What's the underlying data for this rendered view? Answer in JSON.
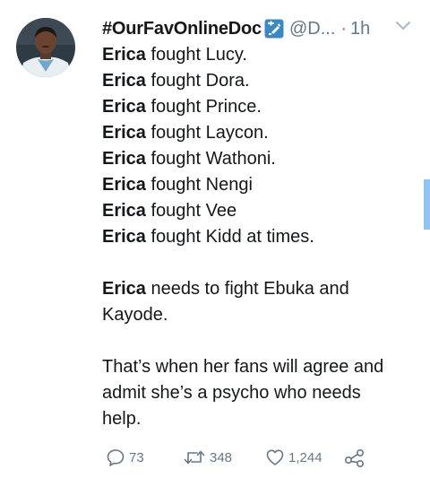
{
  "tweet": {
    "display_name": "#OurFavOnlineDoc",
    "badge_icon": "health-worker-badge-icon",
    "handle": "@D...",
    "separator": "·",
    "time": "1h",
    "lines": [
      {
        "name": "Erica",
        "rest": " fought Lucy."
      },
      {
        "name": "Erica",
        "rest": " fought Dora."
      },
      {
        "name": "Erica",
        "rest": " fought Prince."
      },
      {
        "name": "Erica",
        "rest": " fought Laycon."
      },
      {
        "name": "Erica",
        "rest": " fought Wathoni."
      },
      {
        "name": "Erica",
        "rest": " fought Nengi"
      },
      {
        "name": "Erica",
        "rest": " fought Vee"
      },
      {
        "name": "Erica",
        "rest": " fought Kidd at times."
      }
    ],
    "para2": {
      "name": "Erica",
      "rest_line1": " needs to fight Ebuka and",
      "line2": "Kayode."
    },
    "para3": {
      "line1": "That’s when her fans will agree and",
      "line2": "admit she’s a psycho who needs",
      "line3": "help."
    },
    "actions": {
      "replies": "73",
      "retweets": "348",
      "likes": "1,244"
    }
  },
  "colors": {
    "text": "#14171a",
    "secondary": "#657786",
    "badge_blue": "#3b88c3",
    "scroll_accent": "#8ec5f2"
  }
}
